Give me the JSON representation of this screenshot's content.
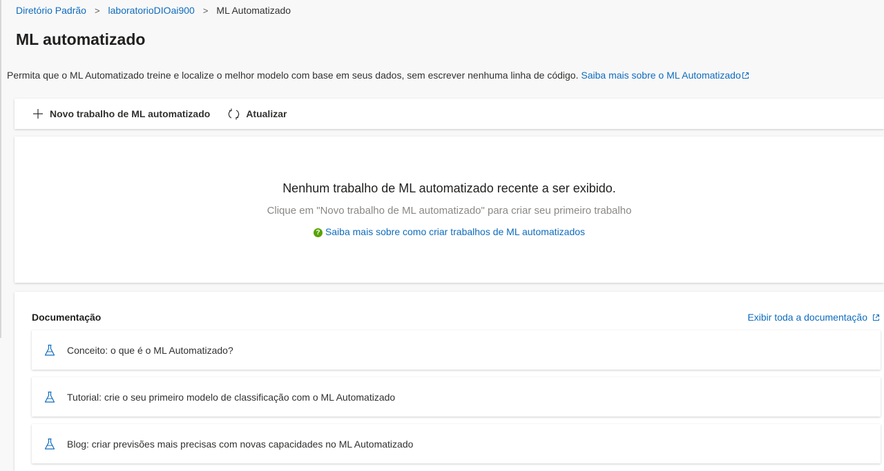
{
  "breadcrumb": {
    "items": [
      "Diretório Padrão",
      "laboratorioDIOai900"
    ],
    "current": "ML Automatizado",
    "separator": ">"
  },
  "page": {
    "title": "ML automatizado",
    "description": "Permita que o ML Automatizado treine e localize o melhor modelo com base em seus dados, sem escrever nenhuma linha de código. ",
    "learn_more": "Saiba mais sobre o ML Automatizado"
  },
  "toolbar": {
    "new_job": "Novo trabalho de ML automatizado",
    "refresh": "Atualizar"
  },
  "empty_state": {
    "title": "Nenhum trabalho de ML automatizado recente a ser exibido.",
    "subtitle": "Clique em \"Novo trabalho de ML automatizado\" para criar seu primeiro trabalho",
    "help_link": "Saiba mais sobre como criar trabalhos de ML automatizados"
  },
  "documentation": {
    "title": "Documentação",
    "view_all": "Exibir toda a documentação",
    "items": [
      "Conceito: o que é o ML Automatizado?",
      "Tutorial: crie o seu primeiro modelo de classificação com o ML Automatizado",
      "Blog: criar previsões mais precisas com novas capacidades no ML Automatizado"
    ]
  },
  "colors": {
    "link": "#0f6cbd",
    "help_icon": "#57a300",
    "page_background": "#f8f8f8"
  }
}
